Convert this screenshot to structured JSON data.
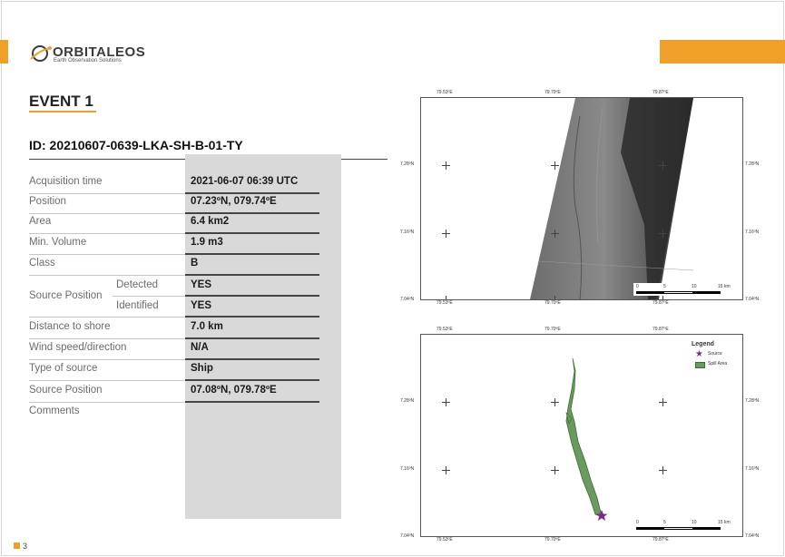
{
  "brand": {
    "name": "ORBITALEOS",
    "tagline": "Earth Observation Solutions",
    "accent_color": "#f0a028"
  },
  "event": {
    "title": "EVENT 1",
    "id": "ID: 20210607-0639-LKA-SH-B-01-TY"
  },
  "rows": {
    "acquisition": {
      "label": "Acquisition time",
      "value": "2021-06-07 06:39 UTC"
    },
    "position": {
      "label": "Position",
      "value": "07.23ºN, 079.74ºE"
    },
    "area": {
      "label": "Area",
      "value": "6.4 km2"
    },
    "min_volume": {
      "label": "Min. Volume",
      "value": "1.9 m3"
    },
    "class": {
      "label": "Class",
      "value": "B"
    },
    "source_position": {
      "label": "Source Position",
      "detected_label": "Detected",
      "detected_value": "YES",
      "identified_label": "Identified",
      "identified_value": "YES"
    },
    "distance": {
      "label": "Distance to shore",
      "value": "7.0 km"
    },
    "wind": {
      "label": "Wind speed/direction",
      "value": "N/A"
    },
    "type_source": {
      "label": "Type of source",
      "value": "Ship"
    },
    "source_position2": {
      "label": "Source Position",
      "value": "07.08ºN, 079.78ºE"
    },
    "comments": {
      "label": "Comments",
      "value": ""
    }
  },
  "map_top": {
    "lon_labels": [
      "79.53ºE",
      "79.70ºE",
      "79.87ºE"
    ],
    "lat_labels": [
      "7.28ºN",
      "7.16ºN",
      "7.04ºN"
    ],
    "scale_labels": [
      "0",
      "5",
      "10",
      "15 km"
    ]
  },
  "map_bottom": {
    "lon_labels": [
      "79.53ºE",
      "79.70ºE",
      "79.87ºE"
    ],
    "lat_labels": [
      "7.28ºN",
      "7.16ºN",
      "7.04ºN"
    ],
    "scale_labels": [
      "0",
      "5",
      "10",
      "15 km"
    ],
    "legend": {
      "title": "Legend",
      "source_label": "Source",
      "spill_label": "Spill Area",
      "source_color": "#7a2b86",
      "spill_color": "#6a9a5e"
    }
  },
  "footer": {
    "page": "3"
  }
}
